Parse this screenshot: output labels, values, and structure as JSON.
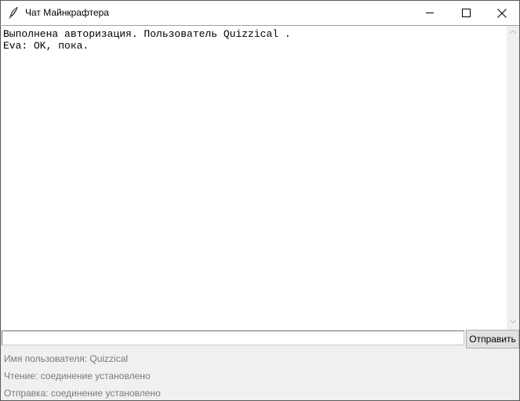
{
  "window": {
    "title": "Чат Майнкрафтера",
    "buttons": [
      "minimize",
      "maximize",
      "close"
    ]
  },
  "chat": {
    "lines": [
      "Выполнена авторизация. Пользователь Quizzical .",
      "Eva: OK, пока."
    ]
  },
  "input": {
    "value": "",
    "send_label": "Отправить"
  },
  "status": {
    "user": "Имя пользователя: Quizzical",
    "read": "Чтение: соединение установлено",
    "send": "Отправка: соединение установлено"
  },
  "icons": {
    "app": "feather-icon",
    "minimize": "minimize-icon",
    "maximize": "maximize-icon",
    "close": "close-icon"
  }
}
